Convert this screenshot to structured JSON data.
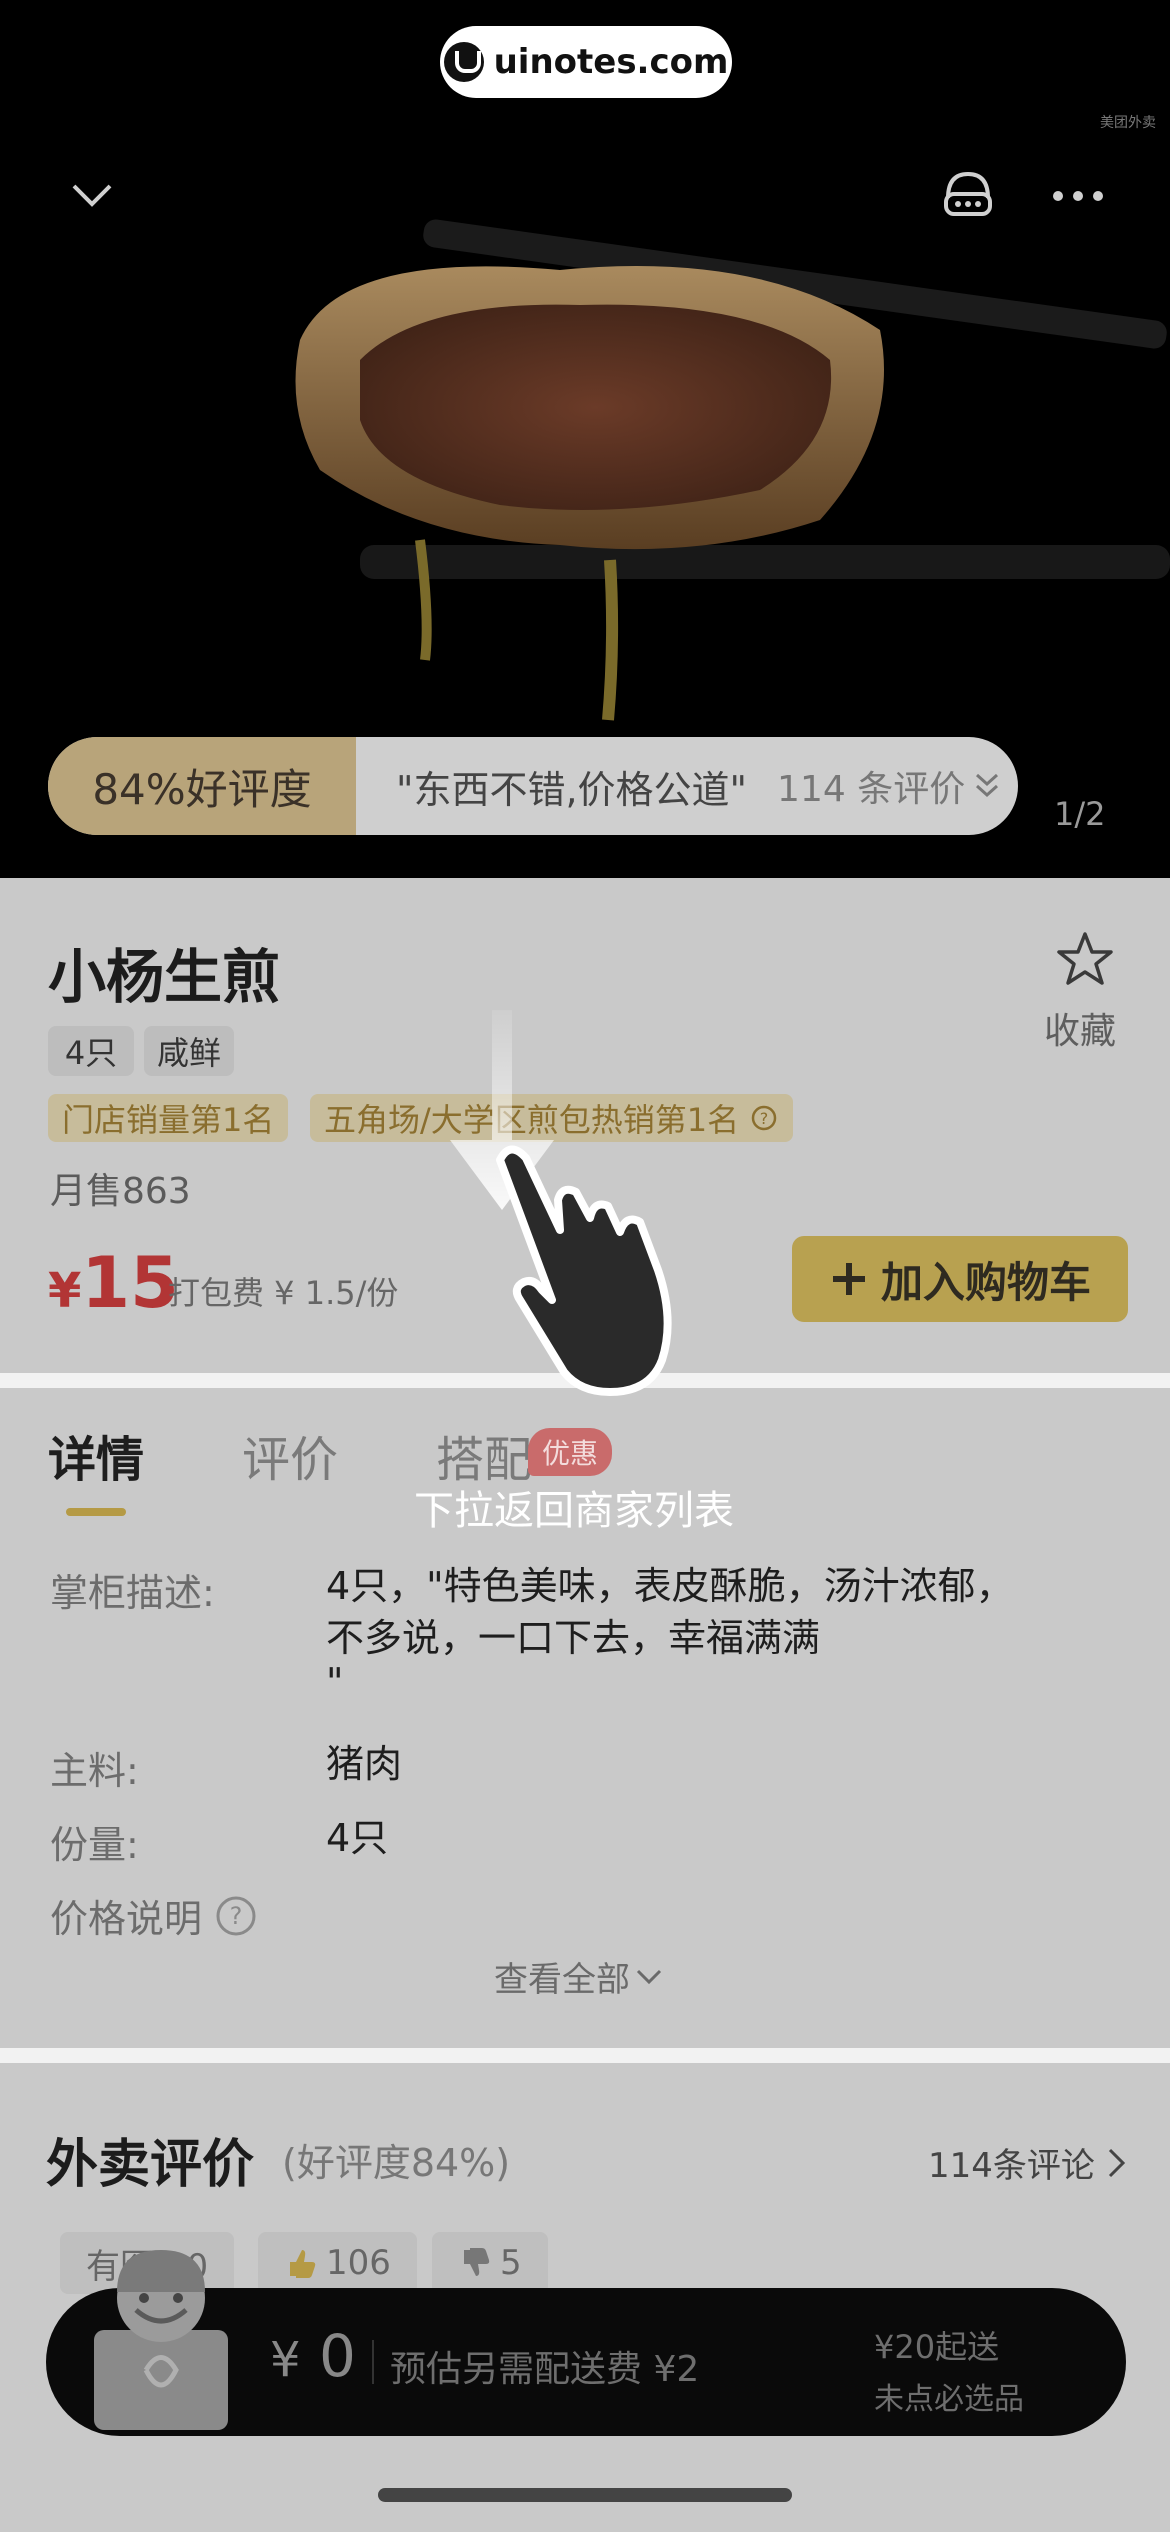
{
  "watermark": "uinotes.com",
  "small_watermark": "美团外卖",
  "hero": {
    "rating_percent": "84%好评度",
    "quote": "\"东西不错,价格公道\"",
    "review_count": "114 条评价",
    "pager": "1/2"
  },
  "product": {
    "name": "小杨生煎",
    "tags": [
      "4只",
      "咸鲜"
    ],
    "ranks": [
      "门店销量第1名",
      "五角场/大学区煎包热销第1名"
    ],
    "monthly_sales": "月售863",
    "price_symbol": "¥",
    "price": "15",
    "packing_fee": "打包费 ¥ 1.5/份",
    "add_to_cart": "加入购物车",
    "favorite_label": "收藏"
  },
  "tabs": [
    {
      "label": "详情",
      "active": true
    },
    {
      "label": "评价",
      "active": false
    },
    {
      "label": "搭配",
      "active": false
    }
  ],
  "tab_badge": "优惠",
  "pull_hint": "下拉返回商家列表",
  "details": {
    "desc_label": "掌柜描述:",
    "desc_line1": "4只，\"特色美味，表皮酥脆，汤汁浓郁，",
    "desc_line2": "不多说，一口下去，幸福满满",
    "desc_line3": "\"",
    "main_label": "主料:",
    "main_value": "猪肉",
    "portion_label": "份量:",
    "portion_value": "4只",
    "price_note_label": "价格说明",
    "view_all": "查看全部"
  },
  "reviews": {
    "title": "外卖评价",
    "subtitle": "(好评度84%)",
    "count": "114条评论",
    "chips": [
      "有图 30",
      "106",
      "5"
    ]
  },
  "bottom_bar": {
    "currency": "¥",
    "total": "0",
    "delivery_fee": "预估另需配送费 ¥2",
    "min_order": "¥20起送",
    "must_pick": "未点必选品"
  },
  "colors": {
    "accent": "#b8a150",
    "price": "#b23535",
    "badge": "#c96b6b"
  }
}
